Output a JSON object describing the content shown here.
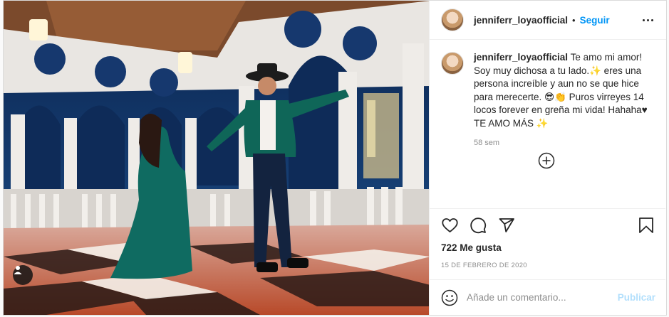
{
  "header": {
    "username": "jenniferr_loyaofficial",
    "separator": "•",
    "follow_label": "Seguir"
  },
  "caption": {
    "username": "jenniferr_loyaofficial",
    "text": "Te amo mi amor! Soy muy dichosa a tu lado.✨ eres una persona increíble y aun no se que hice para merecerte. 😎👏 Puros virreyes 14 locos forever en greña mi vida! Hahaha♥ TE AMO MÁS ✨",
    "time_ago": "58 sem"
  },
  "actions": {
    "likes": "722 Me gusta",
    "date": "15 DE FEBRERO DE 2020"
  },
  "comment": {
    "placeholder": "Añade un comentario...",
    "publish_label": "Publicar"
  },
  "colors": {
    "link_blue": "#0095f6",
    "publish_disabled": "#b2dffc",
    "meta_gray": "#8e8e8e",
    "text": "#262626"
  },
  "icons": [
    "user-tag-icon",
    "more-options-icon",
    "load-more-comments-icon",
    "heart-icon",
    "comment-icon",
    "share-icon",
    "bookmark-icon",
    "emoji-icon"
  ]
}
